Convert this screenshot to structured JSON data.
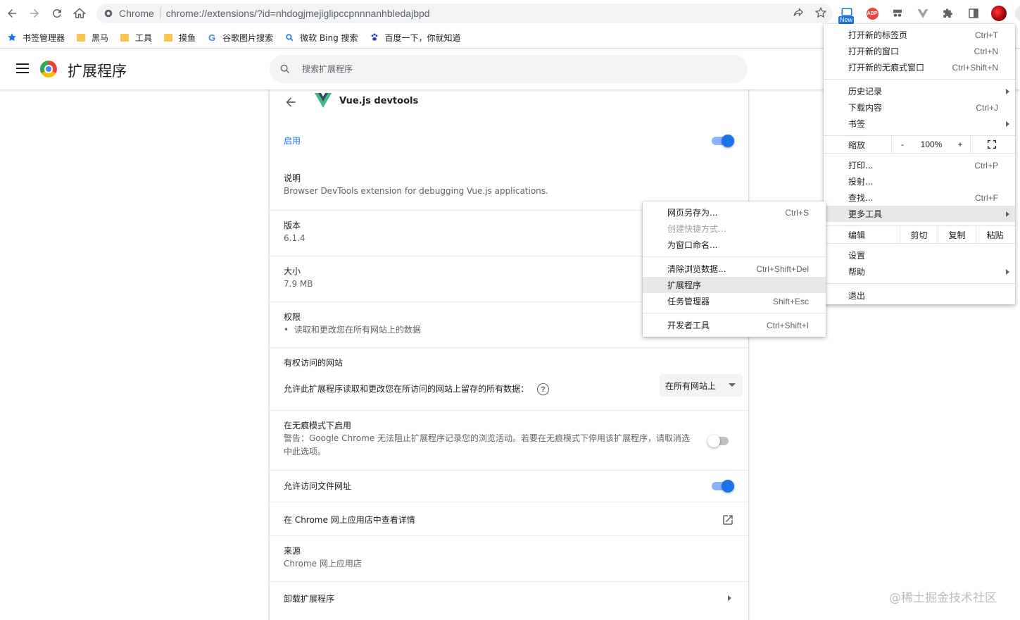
{
  "toolbar": {
    "scheme": "Chrome",
    "url": "chrome://extensions/?id=nhdogjmejiglipccpnnnanhbledajbpd",
    "new_badge": "New",
    "abp_label": "ABP"
  },
  "bookmarks": [
    {
      "label": "书签管理器",
      "icon": "star-icon"
    },
    {
      "label": "黑马",
      "icon": "folder-icon"
    },
    {
      "label": "工具",
      "icon": "folder-icon"
    },
    {
      "label": "摸鱼",
      "icon": "folder-icon"
    },
    {
      "label": "谷歌图片搜索",
      "icon": "google-icon"
    },
    {
      "label": "微软 Bing 搜索",
      "icon": "search-icon"
    },
    {
      "label": "百度一下，你就知道",
      "icon": "baidu-paw-icon"
    }
  ],
  "header": {
    "title": "扩展程序",
    "search_placeholder": "搜索扩展程序"
  },
  "extension": {
    "name": "Vue.js devtools",
    "enabled_label": "启用",
    "enabled": true,
    "description_label": "说明",
    "description": "Browser DevTools extension for debugging Vue.js applications.",
    "version_label": "版本",
    "version": "6.1.4",
    "size_label": "大小",
    "size": "7.9 MB",
    "permissions_label": "权限",
    "permissions": [
      "读取和更改您在所有网站上的数据"
    ],
    "site_access_label": "有权访问的网站",
    "site_access_desc": "允许此扩展程序读取和更改您在所访问的网站上留存的所有数据：",
    "site_access_value": "在所有网站上",
    "incognito_label": "在无痕模式下启用",
    "incognito_warning": "警告：Google Chrome 无法阻止扩展程序记录您的浏览活动。若要在无痕模式下停用该扩展程序，请取消选中此选项。",
    "incognito_enabled": false,
    "file_urls_label": "允许访问文件网址",
    "file_urls_enabled": true,
    "webstore_label": "在 Chrome 网上应用店中查看详情",
    "source_label": "来源",
    "source_value": "Chrome 网上应用店",
    "remove_label": "卸载扩展程序"
  },
  "main_menu": {
    "new_tab": "打开新的标签页",
    "new_tab_sc": "Ctrl+T",
    "new_window": "打开新的窗口",
    "new_window_sc": "Ctrl+N",
    "new_incognito": "打开新的无痕式窗口",
    "new_incognito_sc": "Ctrl+Shift+N",
    "history": "历史记录",
    "downloads": "下载内容",
    "downloads_sc": "Ctrl+J",
    "bookmarks": "书签",
    "zoom": "缩放",
    "zoom_minus": "-",
    "zoom_value": "100%",
    "zoom_plus": "+",
    "print": "打印...",
    "print_sc": "Ctrl+P",
    "cast": "投射...",
    "find": "查找...",
    "find_sc": "Ctrl+F",
    "more_tools": "更多工具",
    "edit": "编辑",
    "cut": "剪切",
    "copy": "复制",
    "paste": "粘贴",
    "settings": "设置",
    "help": "帮助",
    "exit": "退出"
  },
  "more_tools_menu": {
    "save_page": "网页另存为...",
    "save_page_sc": "Ctrl+S",
    "create_shortcut": "创建快捷方式...",
    "name_window": "为窗口命名...",
    "clear_data": "清除浏览数据...",
    "clear_data_sc": "Ctrl+Shift+Del",
    "extensions": "扩展程序",
    "task_manager": "任务管理器",
    "task_manager_sc": "Shift+Esc",
    "devtools": "开发者工具",
    "devtools_sc": "Ctrl+Shift+I"
  },
  "watermark": "@稀土掘金技术社区",
  "colors": {
    "accent": "#1a73e8",
    "highlight": "#e8e8e8"
  }
}
